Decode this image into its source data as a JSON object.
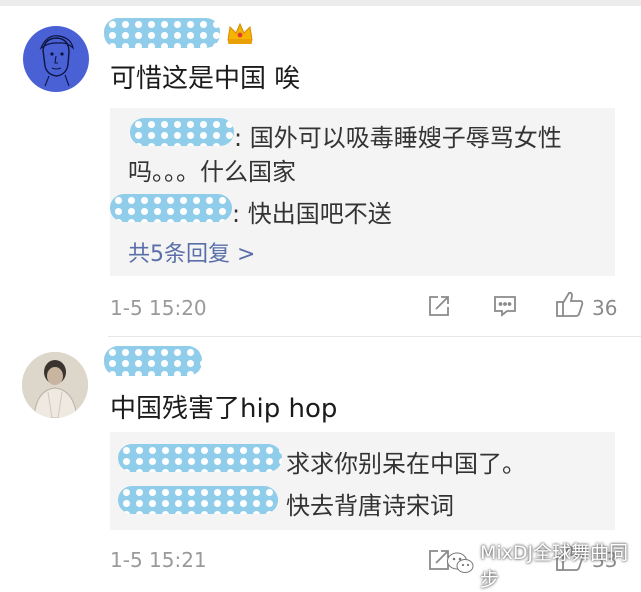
{
  "comments": [
    {
      "text": "可惜这是中国 唉",
      "replies": [
        {
          "line1": ": 国外可以吸毒睡嫂子辱骂女性",
          "line2": "吗。。。什么国家"
        },
        {
          "line1": ": 快出国吧不送"
        }
      ],
      "more_replies": "共5条回复 >",
      "time": "1-5 15:20",
      "likes": "36"
    },
    {
      "text": "中国残害了hip hop",
      "replies": [
        {
          "line1": "求求你别呆在中国了。"
        },
        {
          "line1": "快去背唐诗宋词"
        }
      ],
      "time": "1-5 15:21",
      "likes": "33"
    }
  ],
  "watermark": {
    "text": "MixDJ全球舞曲同步"
  },
  "colors": {
    "redaction": "#8fcdea",
    "reply_bg": "#f4f4f4",
    "more_link": "#5a6fa8"
  },
  "icons": [
    "crown-icon",
    "share-icon",
    "comment-icon",
    "like-icon",
    "wechat-icon"
  ]
}
